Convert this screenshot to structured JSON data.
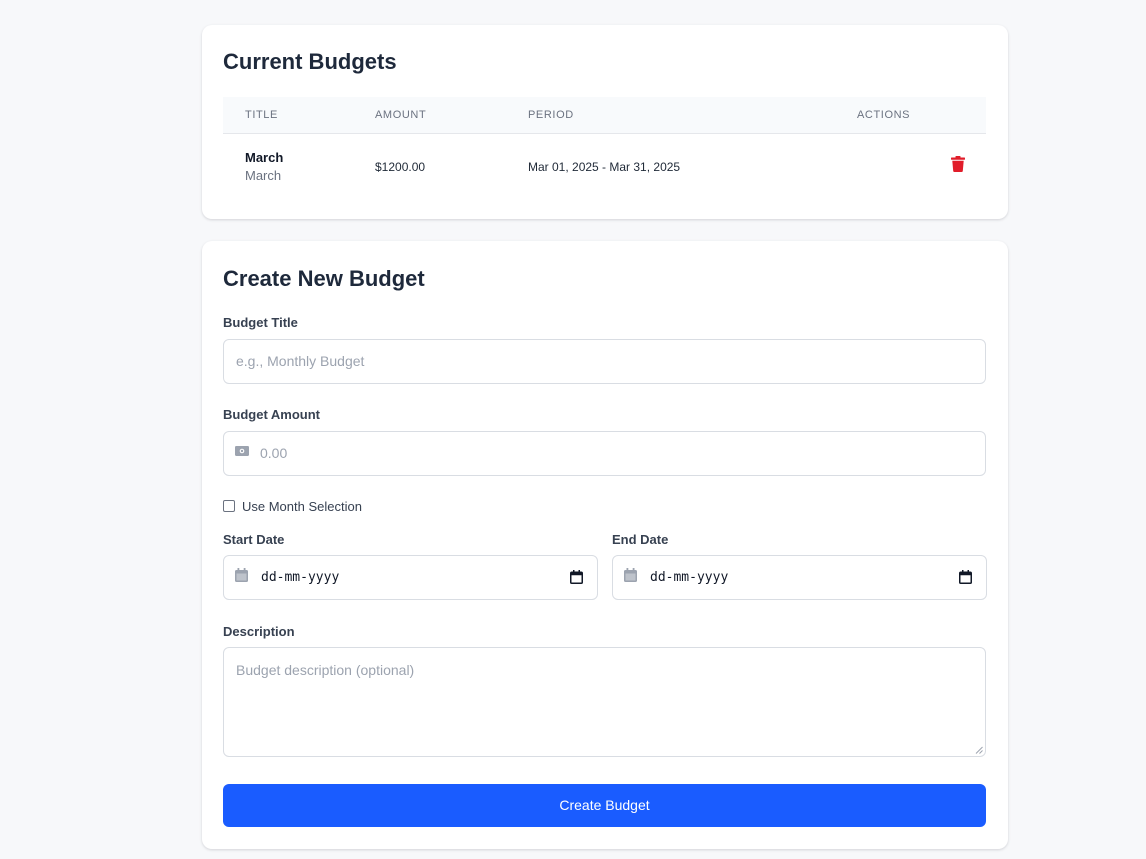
{
  "budgets": {
    "title": "Current Budgets",
    "columns": [
      "TITLE",
      "AMOUNT",
      "PERIOD",
      "ACTIONS"
    ],
    "rows": [
      {
        "title": "March",
        "subtitle": "March",
        "amount": "$1200.00",
        "period": "Mar 01, 2025 - Mar 31, 2025",
        "action_icon": "trash-icon"
      }
    ]
  },
  "form": {
    "title": "Create New Budget",
    "title_label": "Budget Title",
    "title_placeholder": "e.g., Monthly Budget",
    "amount_label": "Budget Amount",
    "amount_placeholder": "0.00",
    "amount_icon": "money-icon",
    "month_selection_label": "Use Month Selection",
    "month_selection_checked": false,
    "start_label": "Start Date",
    "start_value": "dd-mm-yyyy",
    "end_label": "End Date",
    "end_value": "dd-mm-yyyy",
    "description_label": "Description",
    "description_placeholder": "Budget description (optional)",
    "submit_label": "Create Budget"
  },
  "colors": {
    "background": "#f7f8fa",
    "card": "#ffffff",
    "primary": "#1a5cff",
    "danger": "#e11d2a",
    "muted_text": "#6b7280"
  }
}
